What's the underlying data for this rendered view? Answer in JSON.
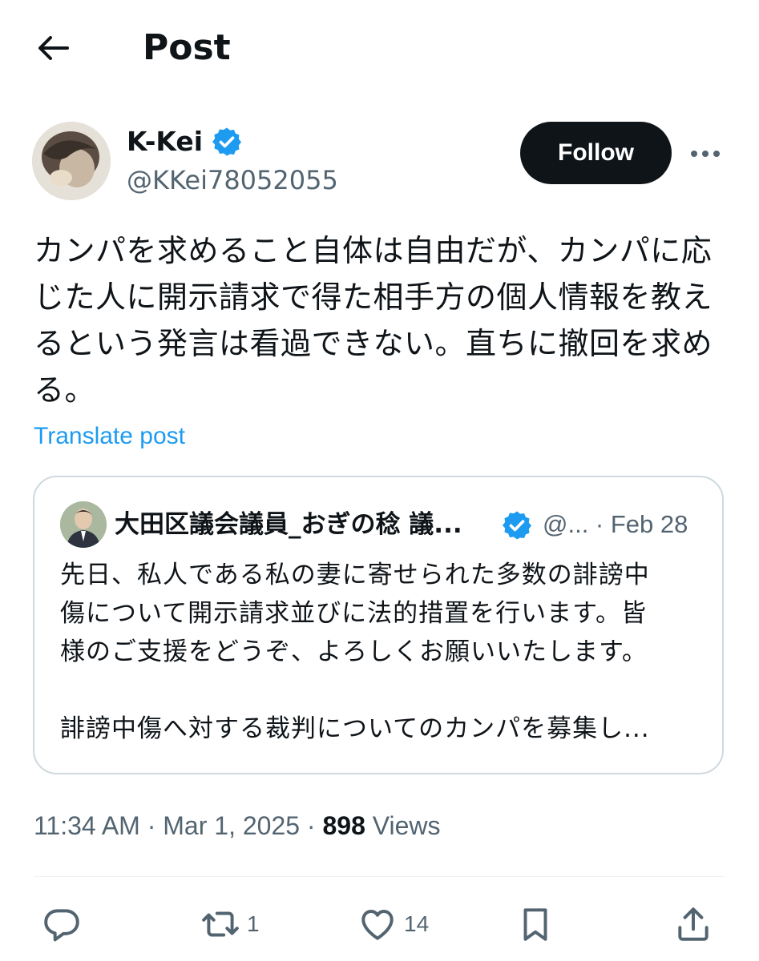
{
  "header": {
    "title": "Post"
  },
  "author": {
    "display_name": "K-Kei",
    "handle": "@KKei78052055",
    "follow_label": "Follow"
  },
  "post": {
    "lines": [
      "カンパを求めること自体は自由だが、カンパに応",
      "じた人に開示請求で得た相手方の個人情報を教え",
      "るという発言は看過できない。直ちに撤回を求め",
      "る。"
    ],
    "translate_label": "Translate post"
  },
  "quote": {
    "display_name": "大田区議会議員_おぎの稔 議...",
    "meta": "@... · Feb 28",
    "lines": [
      "先日、私人である私の妻に寄せられた多数の誹謗中",
      "傷について開示請求並びに法的措置を行います。皆",
      "様のご支援をどうぞ、よろしくお願いいたします。"
    ],
    "tail_line": "誹謗中傷へ対する裁判についてのカンパを募集し..."
  },
  "meta": {
    "time": "11:34 AM",
    "date": "Mar 1, 2025",
    "views_count": "898",
    "views_label": "Views"
  },
  "actions": {
    "reply_count": "",
    "repost_count": "1",
    "like_count": "14"
  },
  "colors": {
    "accent": "#1d9bf0",
    "text": "#0f1419",
    "secondary": "#536471",
    "border": "#cfd9de"
  },
  "icons": [
    "back-arrow-icon",
    "verified-badge-icon",
    "more-icon",
    "reply-icon",
    "repost-icon",
    "like-icon",
    "bookmark-icon",
    "share-icon"
  ]
}
